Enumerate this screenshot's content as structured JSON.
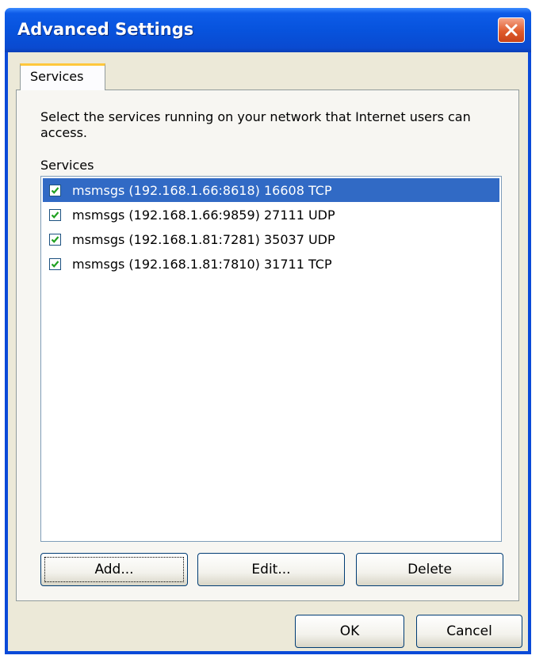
{
  "window": {
    "title": "Advanced Settings"
  },
  "tabs": [
    {
      "label": "Services"
    }
  ],
  "panel": {
    "description": "Select the services running on your network that Internet users can access.",
    "list_label": "Services",
    "services": [
      {
        "label": "msmsgs (192.168.1.66:8618) 16608 TCP",
        "checked": true,
        "selected": true
      },
      {
        "label": "msmsgs (192.168.1.66:9859) 27111 UDP",
        "checked": true,
        "selected": false
      },
      {
        "label": "msmsgs (192.168.1.81:7281) 35037 UDP",
        "checked": true,
        "selected": false
      },
      {
        "label": "msmsgs (192.168.1.81:7810) 31711 TCP",
        "checked": true,
        "selected": false
      }
    ],
    "buttons": {
      "add": "Add...",
      "edit": "Edit...",
      "delete": "Delete"
    }
  },
  "footer": {
    "ok": "OK",
    "cancel": "Cancel"
  },
  "icons": {
    "close": "close-icon",
    "check": "checkmark-icon"
  },
  "colors": {
    "titlebar": "#0a4ad8",
    "selection": "#316ac5",
    "face": "#ece9d8",
    "tab_accent": "#ffc73c",
    "close_button": "#e05c2c"
  }
}
